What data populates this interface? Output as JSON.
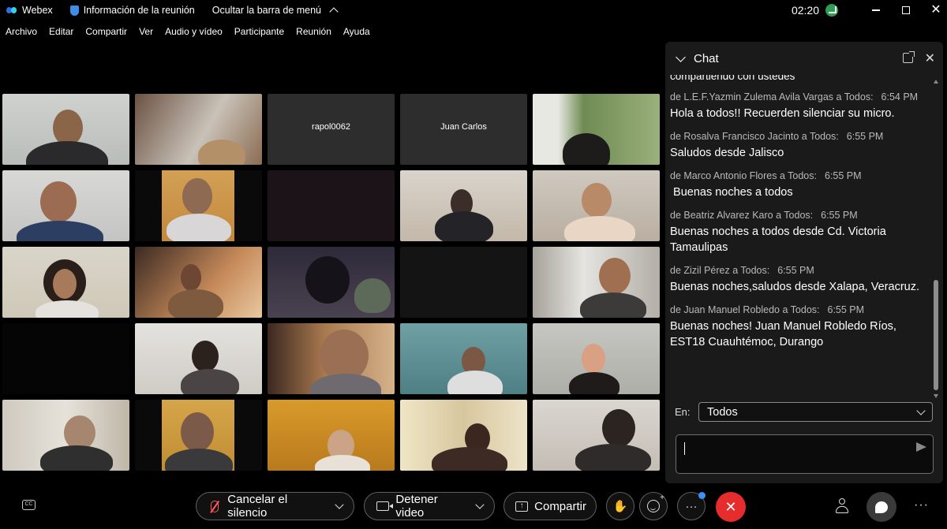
{
  "titlebar": {
    "app_name": "Webex",
    "meeting_info": "Información de la reunión",
    "hide_menu": "Ocultar la barra de menú",
    "clock": "02:20"
  },
  "menu": [
    "Archivo",
    "Editar",
    "Compartir",
    "Ver",
    "Audio y vídeo",
    "Participante",
    "Reunión",
    "Ayuda"
  ],
  "tiles": {
    "t2": "rapol0062",
    "t3": "Juan Carlos"
  },
  "chat": {
    "title": "Chat",
    "partial_message": "compartiendo con ustedes",
    "messages": [
      {
        "from": "de L.E.F.Yazmin Zulema Avila Vargas a Todos:",
        "time": "6:54 PM",
        "text": "Hola a todos!! Recuerden silenciar su micro."
      },
      {
        "from": "de Rosalva Francisco Jacinto a Todos:",
        "time": "6:55 PM",
        "text": "Saludos desde Jalisco"
      },
      {
        "from": "de Marco Antonio Flores a Todos:",
        "time": "6:55 PM",
        "text": " Buenas noches a todos"
      },
      {
        "from": "de Beatriz Alvarez Karo a Todos:",
        "time": "6:55 PM",
        "text": "Buenas noches a todos desde Cd. Victoria Tamaulipas"
      },
      {
        "from": "de Zizil Pérez a Todos:",
        "time": "6:55 PM",
        "text": "Buenas noches,saludos desde Xalapa, Veracruz."
      },
      {
        "from": "de Juan Manuel Robledo a Todos:",
        "time": "6:55 PM",
        "text": "Buenas noches! Juan Manuel Robledo Ríos, EST18 Cuauhtémoc, Durango"
      }
    ],
    "to_label": "En:",
    "to_value": "Todos"
  },
  "controls": {
    "unmute": "Cancelar el silencio",
    "stop_video": "Detener video",
    "share": "Compartir"
  },
  "colors": {
    "end_call": "#e62c2c",
    "accent": "#3e8ef7"
  }
}
